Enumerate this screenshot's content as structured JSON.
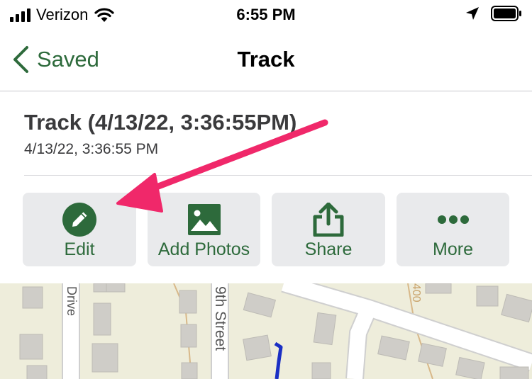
{
  "status_bar": {
    "carrier": "Verizon",
    "time": "6:55 PM",
    "icons": [
      "signal-bars-icon",
      "wifi-icon",
      "location-arrow-icon",
      "battery-icon"
    ]
  },
  "nav": {
    "back_label": "Saved",
    "title": "Track"
  },
  "track": {
    "title": "Track (4/13/22, 3:36:55PM)",
    "datetime": "4/13/22, 3:36:55 PM"
  },
  "actions": [
    {
      "label": "Edit",
      "icon": "pencil-icon"
    },
    {
      "label": "Add Photos",
      "icon": "image-icon"
    },
    {
      "label": "Share",
      "icon": "share-icon"
    },
    {
      "label": "More",
      "icon": "more-dots-icon"
    }
  ],
  "map": {
    "street_labels": [
      "Drive",
      "9th Street",
      "400"
    ]
  },
  "colors": {
    "accent_green": "#2d6a3b",
    "annotation_arrow": "#f0286a",
    "track_line": "#1a2fc4"
  }
}
